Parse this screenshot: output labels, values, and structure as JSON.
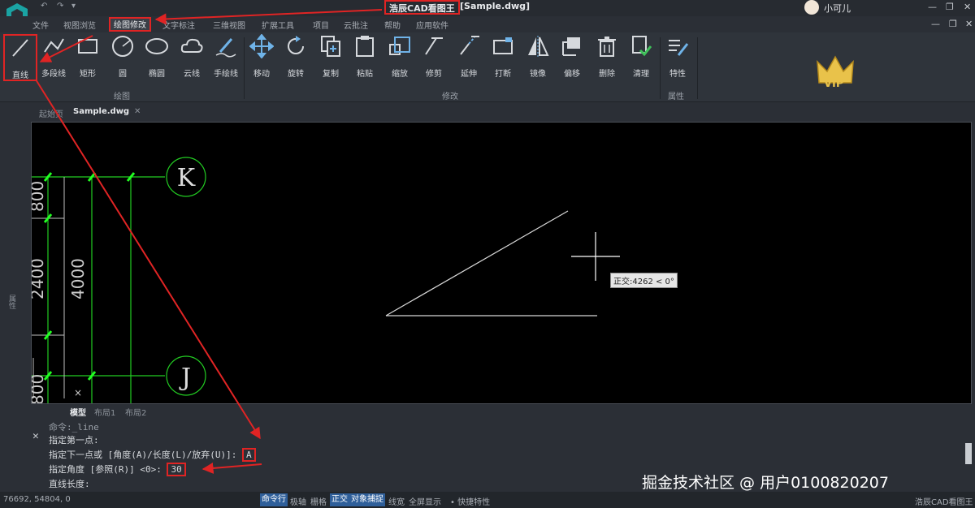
{
  "titlebar": {
    "app_title": "浩辰CAD看图王",
    "doc_title": "[Sample.dwg]",
    "user_name": "小可儿"
  },
  "menu": {
    "items": [
      "文件",
      "视图浏览",
      "绘图修改",
      "文字标注",
      "三维视图",
      "扩展工具",
      "项目",
      "云批注",
      "帮助",
      "应用软件"
    ],
    "active": "绘图修改"
  },
  "ribbon": {
    "draw_tools": [
      "直线",
      "多段线",
      "矩形",
      "圆",
      "椭圆",
      "云线",
      "手绘线"
    ],
    "modify_tools": [
      "移动",
      "旋转",
      "复制",
      "粘贴",
      "缩放",
      "修剪",
      "延伸",
      "打断",
      "镜像",
      "偏移",
      "删除",
      "清理"
    ],
    "property_tools": [
      "特性"
    ],
    "group_draw": "绘图",
    "group_modify": "修改",
    "group_property": "属性",
    "vip_label": "VIP"
  },
  "doc_tabs": {
    "start_tab": "起始页",
    "active_tab": "Sample.dwg"
  },
  "left_strip_label": "属性",
  "canvas": {
    "grid_labels": {
      "k": "K",
      "j": "J",
      "dim_800_top": "800",
      "dim_2400": "2400",
      "dim_4000": "4000",
      "dim_800_bottom": "800"
    },
    "tooltip": "正交:4262 < 0°"
  },
  "layout_tabs": [
    "模型",
    "布局1",
    "布局2"
  ],
  "command": {
    "lines": [
      "命令:_line",
      "指定第一点:",
      "指定下一点或 [角度(A)/长度(L)/放弃(U)]:",
      "指定角度 [参照(R)] <0>:",
      "直线长度:"
    ],
    "answer_a": "A",
    "answer_angle": "30"
  },
  "watermark": "掘金技术社区 @ 用户0100820207",
  "statusbar": {
    "coords": "76692, 54804, 0",
    "items": [
      "命令行",
      "极轴",
      "栅格",
      "正交",
      "对象捕捉",
      "线宽",
      "全屏显示",
      "• 快捷特性"
    ],
    "on": [
      "命令行",
      "正交",
      "对象捕捉"
    ],
    "right_label": "浩辰CAD看图王"
  },
  "colors": {
    "annotation_red": "#e02424",
    "cad_green": "#22cc22",
    "vip_gold": "#e9c24a"
  }
}
